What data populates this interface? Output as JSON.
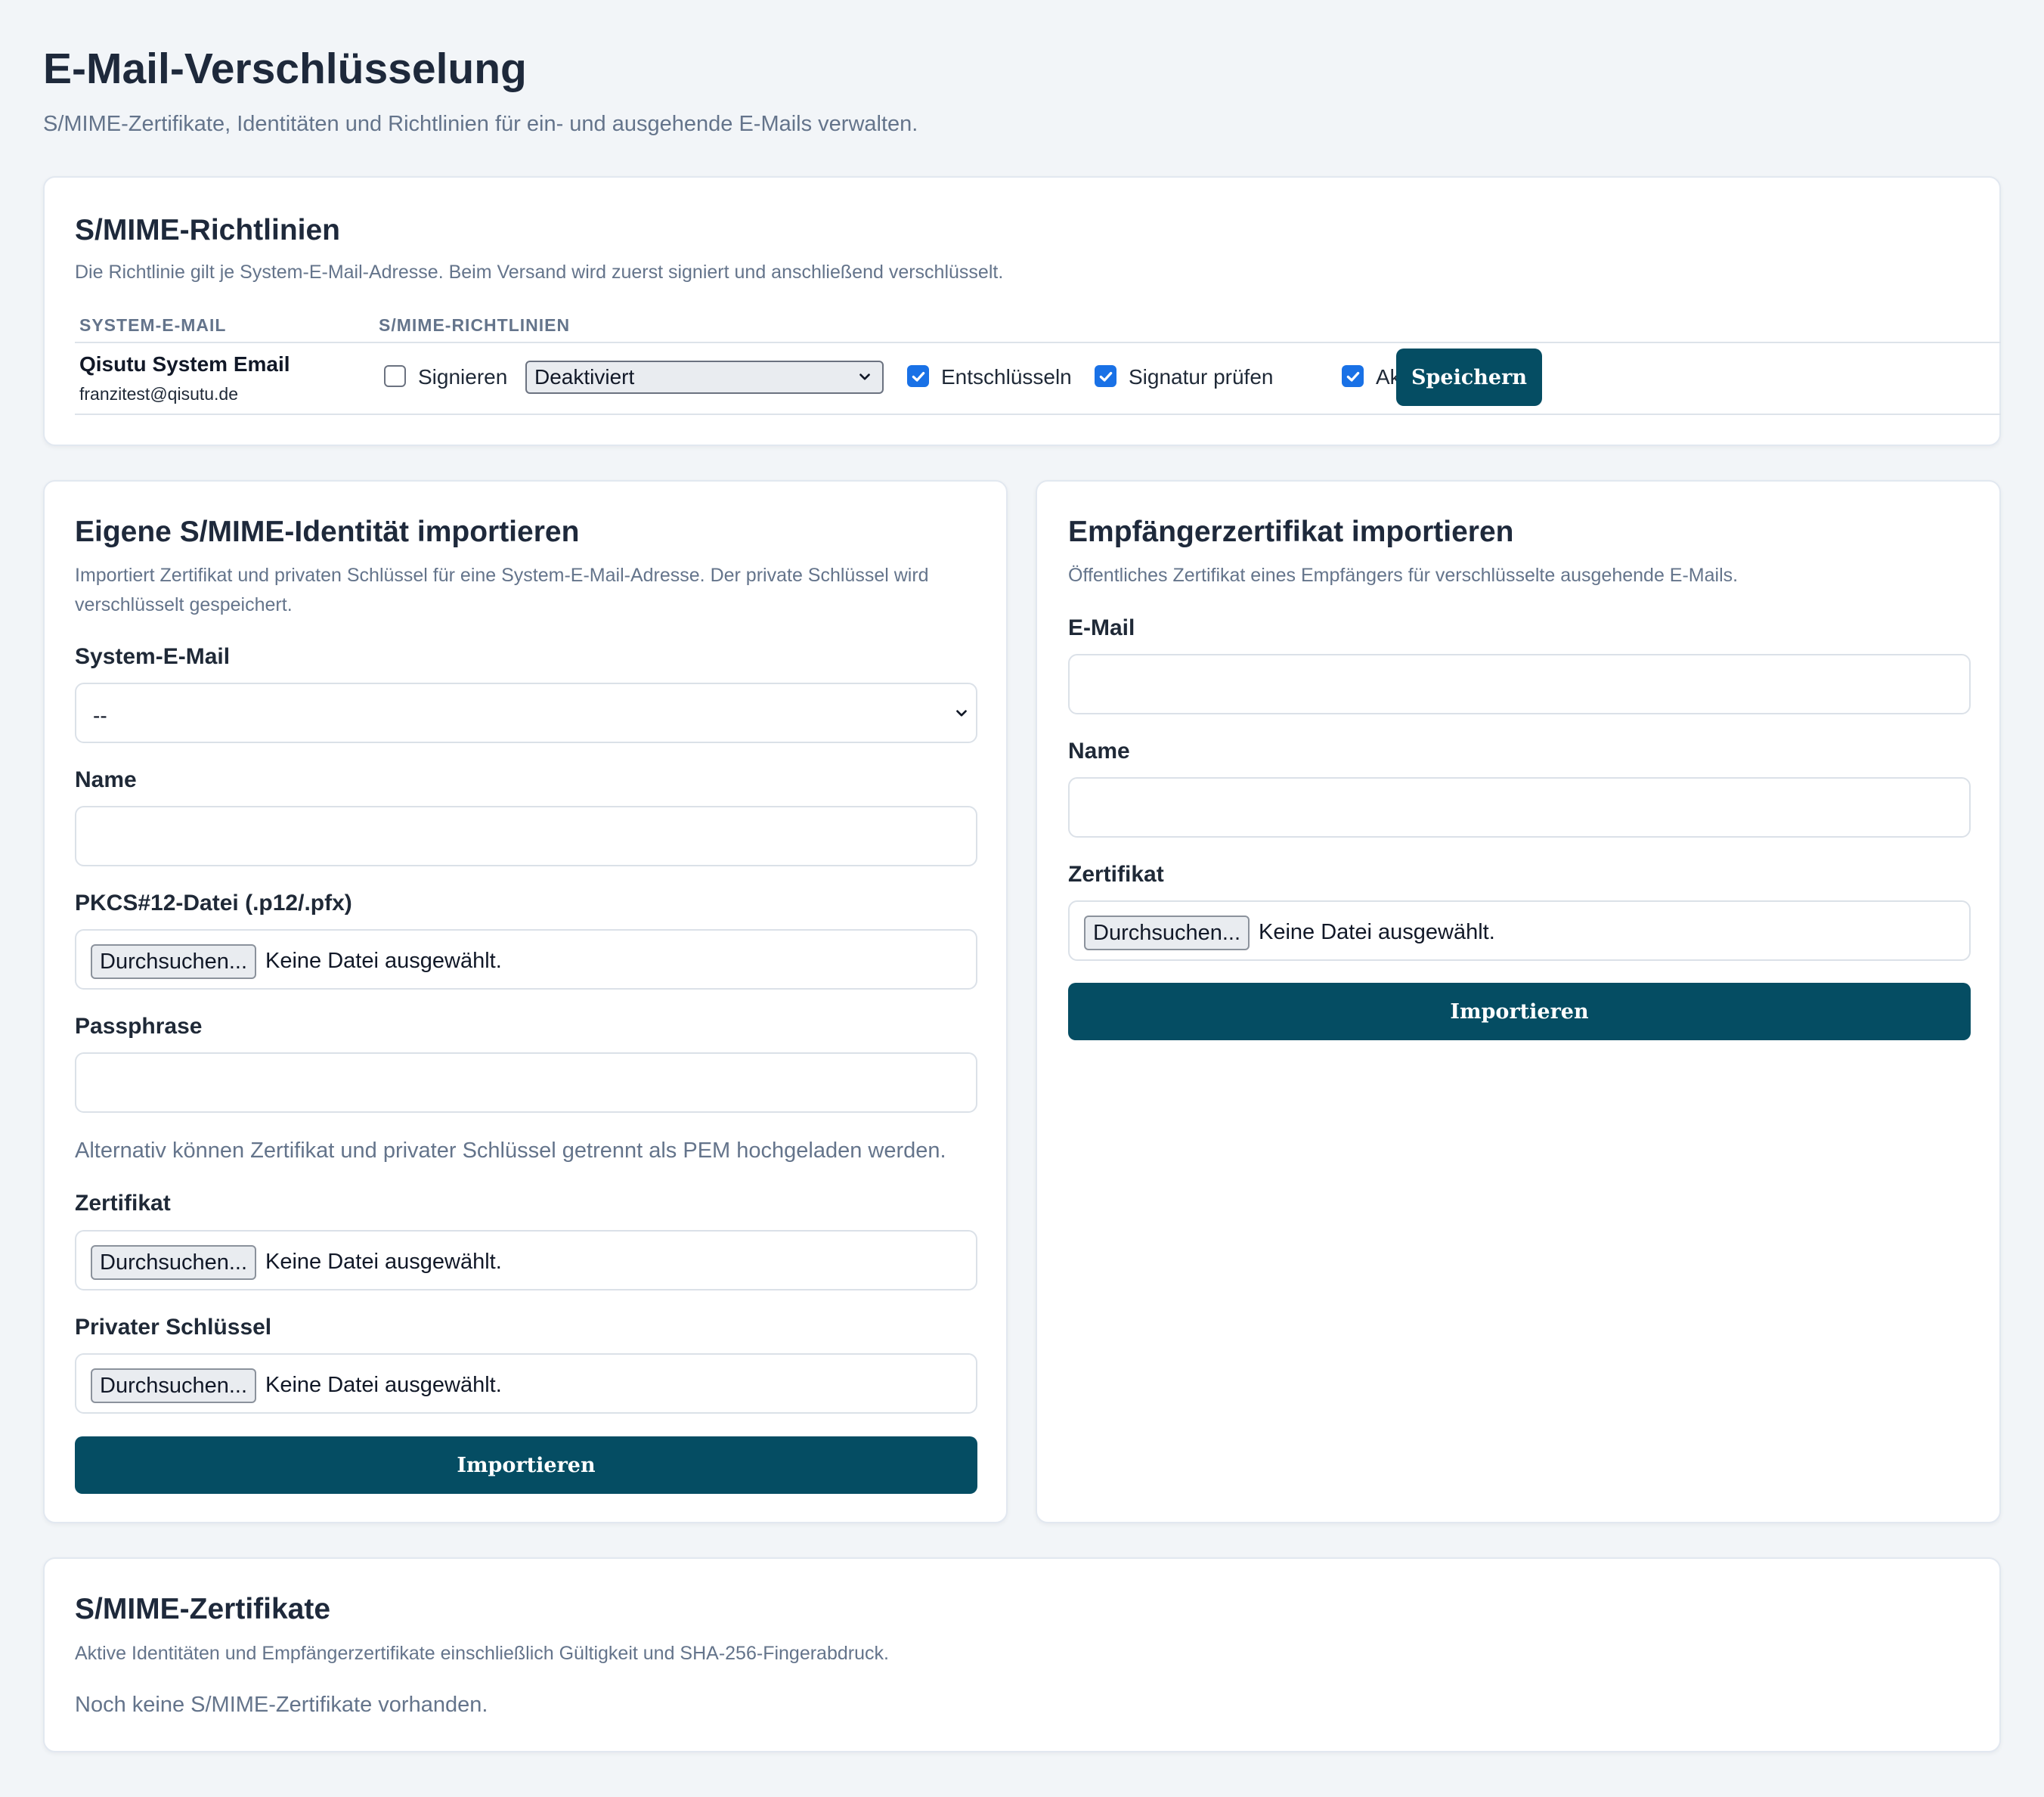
{
  "page": {
    "title": "E-Mail-Verschlüsselung",
    "subtitle": "S/MIME-Zertifikate, Identitäten und Richtlinien für ein- und ausgehende E-Mails verwalten."
  },
  "policies": {
    "title": "S/MIME-Richtlinien",
    "description": "Die Richtlinie gilt je System-E-Mail-Adresse. Beim Versand wird zuerst signiert und anschließend verschlüsselt.",
    "columns": [
      "SYSTEM-E-MAIL",
      "S/MIME-RICHTLINIEN"
    ],
    "rows": [
      {
        "name": "Qisutu System Email",
        "email": "franzitest@qisutu.de",
        "sign_label": "Signieren",
        "sign_checked": false,
        "encryption_mode": "Deaktiviert",
        "decrypt_label": "Entschlüsseln",
        "decrypt_checked": true,
        "verify_label": "Signatur prüfen",
        "verify_checked": true,
        "active_label": "Aktiv",
        "active_checked": true,
        "save_label": "Speichern"
      }
    ]
  },
  "identity_import": {
    "title": "Eigene S/MIME-Identität importieren",
    "description_line1": "Importiert Zertifikat und privaten Schlüssel für eine System-E-Mail-Adresse. Der private Schlüssel wird",
    "description_line2": "verschlüsselt gespeichert.",
    "system_email_label": "System-E-Mail",
    "system_email_value": "--",
    "name_label": "Name",
    "pkcs12_label": "PKCS#12-Datei (.p12/.pfx)",
    "passphrase_label": "Passphrase",
    "alternative_hint": "Alternativ können Zertifikat und privater Schlüssel getrennt als PEM hochgeladen werden.",
    "certificate_label": "Zertifikat",
    "private_key_label": "Privater Schlüssel",
    "browse_label": "Durchsuchen...",
    "no_file_label": "Keine Datei ausgewählt.",
    "submit_label": "Importieren"
  },
  "recipient_import": {
    "title": "Empfängerzertifikat importieren",
    "description": "Öffentliches Zertifikat eines Empfängers für verschlüsselte ausgehende E-Mails.",
    "email_label": "E-Mail",
    "name_label": "Name",
    "certificate_label": "Zertifikat",
    "browse_label": "Durchsuchen...",
    "no_file_label": "Keine Datei ausgewählt.",
    "submit_label": "Importieren"
  },
  "certificates": {
    "title": "S/MIME-Zertifikate",
    "description": "Aktive Identitäten und Empfängerzertifikate einschließlich Gültigkeit und SHA-256-Fingerabdruck.",
    "empty_message": "Noch keine S/MIME-Zertifikate vorhanden."
  },
  "colors": {
    "primary": "#054d63",
    "checkbox": "#1971e6",
    "muted_text": "#64748b",
    "background": "#f2f5f8"
  }
}
